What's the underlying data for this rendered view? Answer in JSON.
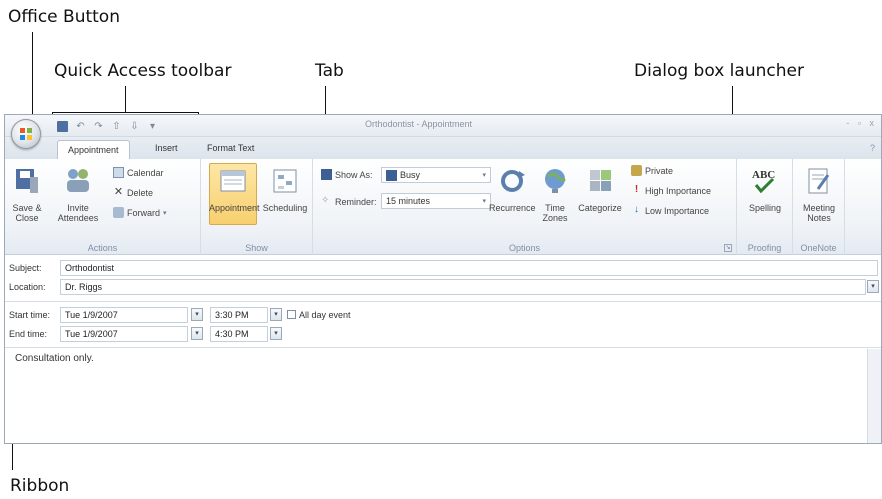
{
  "callouts": {
    "office_button": "Office Button",
    "quick_access": "Quick Access toolbar",
    "tab": "Tab",
    "dialog_launcher": "Dialog box launcher",
    "ribbon": "Ribbon"
  },
  "window": {
    "title": "Orthodontist - Appointment",
    "controls": "- ▫ x"
  },
  "tabs": [
    "Appointment",
    "Insert",
    "Format Text"
  ],
  "ribbon": {
    "actions": {
      "save_close": "Save & Close",
      "invite": "Invite Attendees",
      "calendar": "Calendar",
      "delete": "Delete",
      "forward": "Forward",
      "label": "Actions"
    },
    "show": {
      "appointment": "Appointment",
      "scheduling": "Scheduling",
      "label": "Show"
    },
    "options": {
      "show_as_label": "Show As:",
      "show_as_value": "Busy",
      "reminder_label": "Reminder:",
      "reminder_value": "15 minutes",
      "recurrence": "Recurrence",
      "time_zones": "Time Zones",
      "categorize": "Categorize",
      "private": "Private",
      "high_importance": "High Importance",
      "low_importance": "Low Importance",
      "label": "Options"
    },
    "proofing": {
      "spelling": "Spelling",
      "label": "Proofing"
    },
    "onenote": {
      "meeting_notes": "Meeting Notes",
      "label": "OneNote"
    }
  },
  "form": {
    "subject_label": "Subject:",
    "subject_value": "Orthodontist",
    "location_label": "Location:",
    "location_value": "Dr. Riggs",
    "start_label": "Start time:",
    "start_date": "Tue 1/9/2007",
    "start_time": "3:30 PM",
    "all_day": "All day event",
    "end_label": "End time:",
    "end_date": "Tue 1/9/2007",
    "end_time": "4:30 PM",
    "body": "Consultation only."
  },
  "colors": {
    "ribbon_bg": "#eef2f6",
    "selected_button": "#f8cf6e",
    "accent": "#4d6fa3"
  }
}
